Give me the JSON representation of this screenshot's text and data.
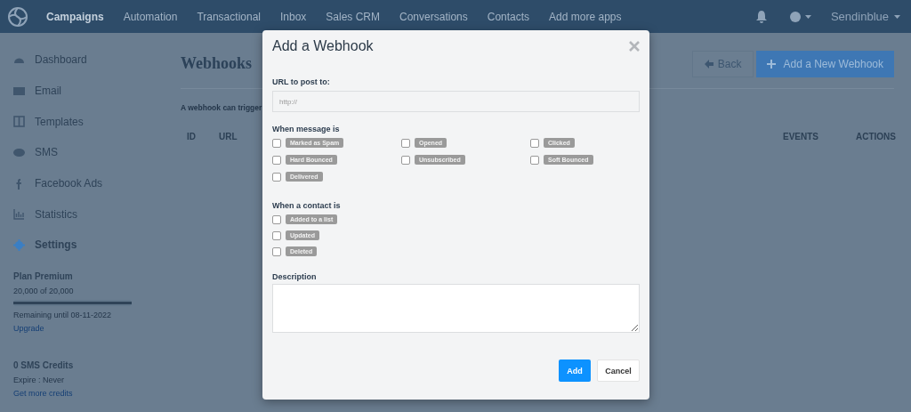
{
  "nav": {
    "items": [
      {
        "label": "Campaigns",
        "selected": true
      },
      {
        "label": "Automation",
        "selected": false
      },
      {
        "label": "Transactional",
        "selected": false
      },
      {
        "label": "Inbox",
        "selected": false
      },
      {
        "label": "Sales CRM",
        "selected": false
      },
      {
        "label": "Conversations",
        "selected": false
      },
      {
        "label": "Contacts",
        "selected": false
      },
      {
        "label": "Add more apps",
        "selected": false
      }
    ],
    "account": "Sendinblue"
  },
  "sidebar": {
    "items": [
      {
        "label": "Dashboard",
        "selected": false
      },
      {
        "label": "Email",
        "selected": false
      },
      {
        "label": "Templates",
        "selected": false
      },
      {
        "label": "SMS",
        "selected": false
      },
      {
        "label": "Facebook Ads",
        "selected": false
      },
      {
        "label": "Statistics",
        "selected": false
      },
      {
        "label": "Settings",
        "selected": true
      }
    ],
    "plan": {
      "title": "Plan Premium",
      "usage": "20,000 of 20,000",
      "level": 1,
      "remaining": "Remaining until 08-11-2022",
      "link": "Upgrade"
    },
    "sms": {
      "title": "0 SMS Credits",
      "expire": "Expire : Never",
      "link": "Get more credits"
    }
  },
  "page": {
    "title": "Webhooks",
    "back": "Back",
    "add": "Add a New Webhook",
    "intro": "A webhook can trigger",
    "columns": [
      "ID",
      "URL",
      "EVENTS",
      "ACTIONS"
    ]
  },
  "modal": {
    "title": "Add a Webhook",
    "url_label": "URL to post to:",
    "url_placeholder": "http://",
    "sections": [
      {
        "title": "When message is",
        "options": [
          {
            "label": "Marked as Spam",
            "checked": false
          },
          {
            "label": "Opened",
            "checked": false
          },
          {
            "label": "Clicked",
            "checked": false
          },
          {
            "label": "Hard Bounced",
            "checked": false
          },
          {
            "label": "Unsubscribed",
            "checked": false
          },
          {
            "label": "Soft Bounced",
            "checked": false
          },
          {
            "label": "Delivered",
            "checked": false
          }
        ]
      },
      {
        "title": "When a contact is",
        "options": [
          {
            "label": "Added to a list",
            "checked": false
          },
          {
            "label": "Updated",
            "checked": false
          },
          {
            "label": "Deleted",
            "checked": false
          }
        ]
      }
    ],
    "description_label": "Description",
    "primary": "Add",
    "secondary": "Cancel"
  }
}
